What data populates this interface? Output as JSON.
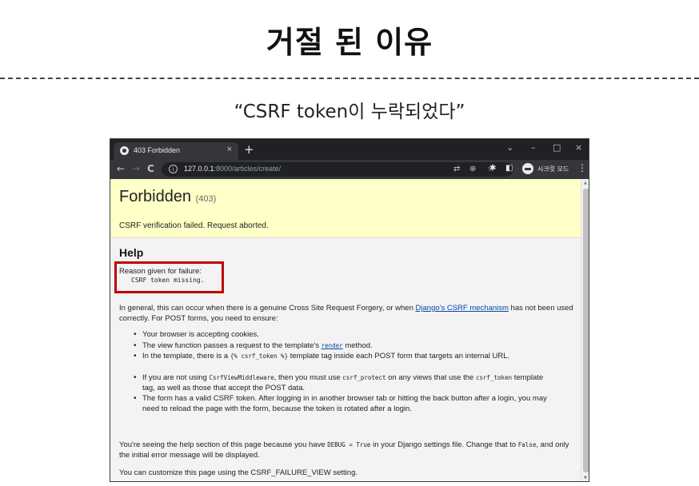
{
  "slide": {
    "title": "거절 된 이유",
    "subtitle": "“CSRF token이 누락되었다”"
  },
  "browser": {
    "tab_title": "403 Forbidden",
    "tab_close": "×",
    "new_tab": "+",
    "window_controls": {
      "chevron": "⌄",
      "minimize": "–",
      "maximize": "□",
      "close": "×"
    },
    "nav": {
      "back": "←",
      "forward": "→",
      "reload": "C"
    },
    "url_host": "127.0.0.1",
    "url_path": ":8000/articles/create/",
    "incognito_label": "시크릿 모드",
    "icons": [
      "info-icon",
      "translate-icon",
      "zoom-icon",
      "star-icon",
      "extensions-icon",
      "sidepanel-icon",
      "incognito-icon",
      "menu-icon"
    ]
  },
  "page": {
    "heading": "Forbidden",
    "status_code": "(403)",
    "summary_message": "CSRF verification failed. Request aborted.",
    "help_title": "Help",
    "reason_label": "Reason given for failure:",
    "reason_value": "CSRF token missing.",
    "intro_before_link": "In general, this can occur when there is a genuine Cross Site Request Forgery, or when ",
    "intro_link": "Django's CSRF mechanism",
    "intro_after_link": " has not been used correctly. For POST forms, you need to ensure:",
    "bullets": {
      "b1": "Your browser is accepting cookies.",
      "b2_before": "The view function passes a request to the template's ",
      "b2_link": "render",
      "b2_after": " method.",
      "b3_before": "In the template, there is a ",
      "b3_code": "{% csrf_token %}",
      "b3_after": " template tag inside each POST form that targets an internal URL.",
      "b4_before": "If you are not using ",
      "b4_code1": "CsrfViewMiddleware",
      "b4_mid": ", then you must use ",
      "b4_code2": "csrf_protect",
      "b4_mid2": " on any views that use the ",
      "b4_code3": "csrf_token",
      "b4_after": " template tag, as well as those that accept the POST data.",
      "b5": "The form has a valid CSRF token. After logging in in another browser tab or hitting the back button after a login, you may need to reload the page with the form, because the token is rotated after a login."
    },
    "debug_before": "You're seeing the help section of this page because you have ",
    "debug_code1": "DEBUG = True",
    "debug_mid": " in your Django settings file. Change that to ",
    "debug_code2": "False",
    "debug_after": ", and only the initial error message will be displayed.",
    "customize": "You can customize this page using the CSRF_FAILURE_VIEW setting."
  },
  "colors": {
    "highlight_box": "#c00000",
    "summary_bg": "#ffffc8",
    "link": "#0645ad",
    "browser_frame": "#202124"
  }
}
